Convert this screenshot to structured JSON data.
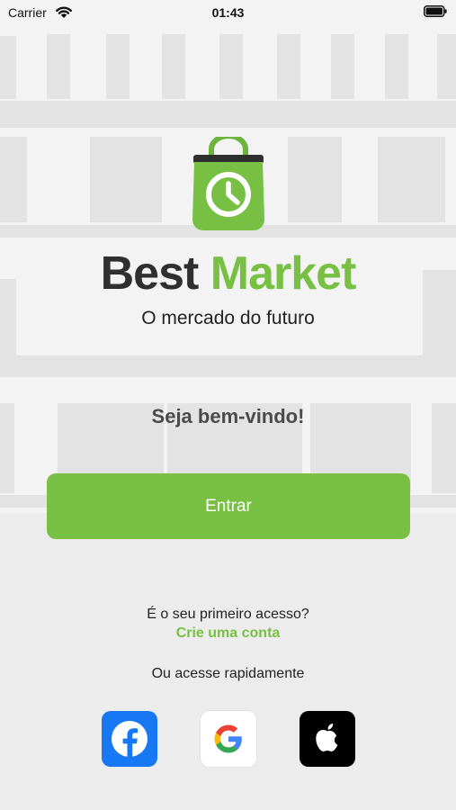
{
  "status_bar": {
    "carrier": "Carrier",
    "time": "01:43"
  },
  "brand": {
    "part1": "Best",
    "part2": "Market",
    "tagline": "O mercado do futuro"
  },
  "welcome": "Seja bem-vindo!",
  "enter_button": "Entrar",
  "signup": {
    "question": "É o seu primeiro acesso?",
    "link": "Crie uma conta"
  },
  "quick_login": {
    "label": "Ou acesse rapidamente"
  },
  "social_icons": [
    "facebook-icon",
    "google-icon",
    "apple-icon"
  ],
  "colors": {
    "accent": "#78c044",
    "brand_dark": "#2f2f2f",
    "facebook": "#1877f2",
    "background": "#ececec"
  }
}
